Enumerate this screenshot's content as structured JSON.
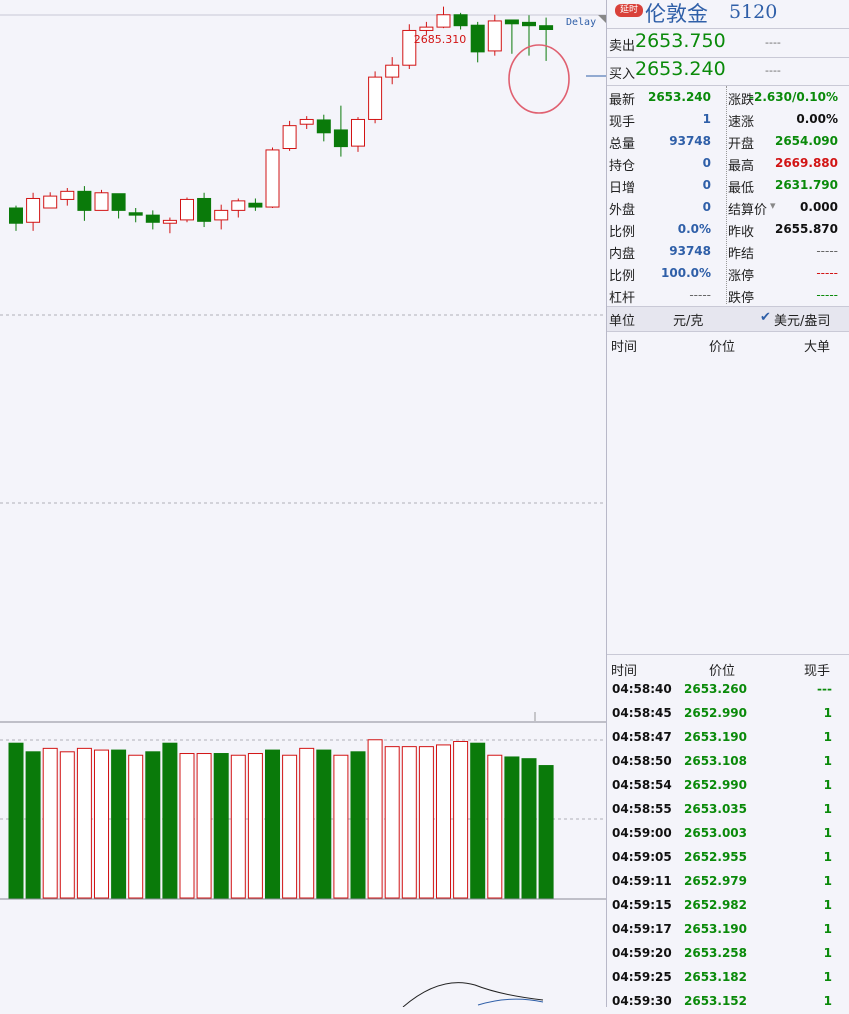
{
  "chart_data": {
    "type": "candlestick",
    "high_annotation": "2685.310",
    "delay_label": "Delay",
    "candles": [
      {
        "o": 2643.0,
        "h": 2643.5,
        "l": 2638.2,
        "c": 2639.8
      },
      {
        "o": 2640.0,
        "h": 2646.2,
        "l": 2638.2,
        "c": 2645.0
      },
      {
        "o": 2643.0,
        "h": 2646.3,
        "l": 2643.0,
        "c": 2645.5
      },
      {
        "o": 2644.8,
        "h": 2647.2,
        "l": 2643.5,
        "c": 2646.5
      },
      {
        "o": 2646.5,
        "h": 2647.6,
        "l": 2640.3,
        "c": 2642.5
      },
      {
        "o": 2642.5,
        "h": 2646.8,
        "l": 2642.5,
        "c": 2646.2
      },
      {
        "o": 2646.0,
        "h": 2646.0,
        "l": 2640.8,
        "c": 2642.5
      },
      {
        "o": 2642.0,
        "h": 2643.0,
        "l": 2640.0,
        "c": 2641.5
      },
      {
        "o": 2641.5,
        "h": 2642.5,
        "l": 2638.5,
        "c": 2640.0
      },
      {
        "o": 2639.8,
        "h": 2641.0,
        "l": 2637.7,
        "c": 2640.4
      },
      {
        "o": 2640.5,
        "h": 2645.2,
        "l": 2640.0,
        "c": 2644.8
      },
      {
        "o": 2645.0,
        "h": 2646.2,
        "l": 2639.0,
        "c": 2640.2
      },
      {
        "o": 2640.5,
        "h": 2643.7,
        "l": 2638.5,
        "c": 2642.5
      },
      {
        "o": 2642.5,
        "h": 2645.0,
        "l": 2641.0,
        "c": 2644.5
      },
      {
        "o": 2644.0,
        "h": 2645.0,
        "l": 2642.4,
        "c": 2643.2
      },
      {
        "o": 2643.2,
        "h": 2655.7,
        "l": 2643.0,
        "c": 2655.2
      },
      {
        "o": 2655.5,
        "h": 2661.3,
        "l": 2655.0,
        "c": 2660.3
      },
      {
        "o": 2660.6,
        "h": 2662.3,
        "l": 2659.6,
        "c": 2661.6
      },
      {
        "o": 2661.5,
        "h": 2662.6,
        "l": 2657.0,
        "c": 2658.8
      },
      {
        "o": 2659.4,
        "h": 2664.5,
        "l": 2653.8,
        "c": 2655.9
      },
      {
        "o": 2656.0,
        "h": 2662.1,
        "l": 2654.8,
        "c": 2661.6
      },
      {
        "o": 2661.6,
        "h": 2671.7,
        "l": 2660.8,
        "c": 2670.5
      },
      {
        "o": 2670.5,
        "h": 2674.7,
        "l": 2669.0,
        "c": 2673.0
      },
      {
        "o": 2673.0,
        "h": 2681.6,
        "l": 2672.2,
        "c": 2680.3
      },
      {
        "o": 2680.3,
        "h": 2682.1,
        "l": 2679.3,
        "c": 2681.0
      },
      {
        "o": 2681.0,
        "h": 2685.31,
        "l": 2680.8,
        "c": 2683.6
      },
      {
        "o": 2683.6,
        "h": 2684.0,
        "l": 2680.5,
        "c": 2681.3
      },
      {
        "o": 2681.4,
        "h": 2682.1,
        "l": 2673.6,
        "c": 2675.8
      },
      {
        "o": 2676.0,
        "h": 2683.6,
        "l": 2675.0,
        "c": 2682.3
      },
      {
        "o": 2682.5,
        "h": 2682.6,
        "l": 2675.4,
        "c": 2681.7
      },
      {
        "o": 2682.0,
        "h": 2683.5,
        "l": 2675.0,
        "c": 2681.3
      },
      {
        "o": 2681.3,
        "h": 2683.0,
        "l": 2673.9,
        "c": 2680.5
      }
    ],
    "volumes": [
      90,
      85,
      87,
      85,
      87,
      86,
      86,
      83,
      85,
      90,
      84,
      84,
      84,
      83,
      84,
      86,
      83,
      87,
      86,
      83,
      85,
      92,
      88,
      88,
      88,
      89,
      91,
      90,
      83,
      82,
      81,
      77
    ],
    "volume_colors": [
      "down",
      "down",
      "up",
      "up",
      "up",
      "up",
      "down",
      "up",
      "down",
      "down",
      "up",
      "up",
      "down",
      "up",
      "up",
      "down",
      "up",
      "up",
      "down",
      "up",
      "down",
      "up",
      "up",
      "up",
      "up",
      "up",
      "up",
      "down",
      "up",
      "down",
      "down",
      "down"
    ]
  },
  "header": {
    "badge": "延时",
    "name": "伦敦金",
    "code": "5120"
  },
  "quotes": {
    "sell_label": "卖出",
    "sell_price": "2653.750",
    "sell_vol": "----",
    "buy_label": "买入",
    "buy_price": "2653.240",
    "buy_vol": "----"
  },
  "stats_left": [
    {
      "label": "最新",
      "value": "2653.240",
      "cls": "green"
    },
    {
      "label": "现手",
      "value": "1",
      "cls": "blue"
    },
    {
      "label": "总量",
      "value": "93748",
      "cls": "blue"
    },
    {
      "label": "持仓",
      "value": "0",
      "cls": "blue"
    },
    {
      "label": "日增",
      "value": "0",
      "cls": "blue"
    },
    {
      "label": "外盘",
      "value": "0",
      "cls": "blue"
    },
    {
      "label": "比例",
      "value": "0.0%",
      "cls": "blue"
    },
    {
      "label": "内盘",
      "value": "93748",
      "cls": "blue"
    },
    {
      "label": "比例",
      "value": "100.0%",
      "cls": "blue"
    },
    {
      "label": "杠杆",
      "value": "-----",
      "cls": "dash-gray"
    }
  ],
  "stats_right": [
    {
      "label": "涨跌",
      "value": "-2.630/0.10%",
      "cls": "green"
    },
    {
      "label": "速涨",
      "value": "0.00%",
      "cls": "black"
    },
    {
      "label": "开盘",
      "value": "2654.090",
      "cls": "green"
    },
    {
      "label": "最高",
      "value": "2669.880",
      "cls": "red"
    },
    {
      "label": "最低",
      "value": "2631.790",
      "cls": "green"
    },
    {
      "label": "结算价",
      "value": "0.000",
      "cls": "black"
    },
    {
      "label": "昨收",
      "value": "2655.870",
      "cls": "black"
    },
    {
      "label": "昨结",
      "value": "-----",
      "cls": "dash-gray"
    },
    {
      "label": "涨停",
      "value": "-----",
      "cls": "dash-red"
    },
    {
      "label": "跌停",
      "value": "-----",
      "cls": "dash-green"
    }
  ],
  "units": {
    "label": "单位",
    "option1": "元/克",
    "option2": "美元/盎司"
  },
  "big_orders_header": {
    "time": "时间",
    "price": "价位",
    "big": "大单"
  },
  "ticks_header": {
    "time": "时间",
    "price": "价位",
    "vol": "现手"
  },
  "ticks": [
    {
      "time": "04:58:40",
      "price": "2653.260",
      "vol": "---"
    },
    {
      "time": "04:58:45",
      "price": "2652.990",
      "vol": "1"
    },
    {
      "time": "04:58:47",
      "price": "2653.190",
      "vol": "1"
    },
    {
      "time": "04:58:50",
      "price": "2653.108",
      "vol": "1"
    },
    {
      "time": "04:58:54",
      "price": "2652.990",
      "vol": "1"
    },
    {
      "time": "04:58:55",
      "price": "2653.035",
      "vol": "1"
    },
    {
      "time": "04:59:00",
      "price": "2653.003",
      "vol": "1"
    },
    {
      "time": "04:59:05",
      "price": "2652.955",
      "vol": "1"
    },
    {
      "time": "04:59:11",
      "price": "2652.979",
      "vol": "1"
    },
    {
      "time": "04:59:15",
      "price": "2652.982",
      "vol": "1"
    },
    {
      "time": "04:59:17",
      "price": "2653.190",
      "vol": "1"
    },
    {
      "time": "04:59:20",
      "price": "2653.258",
      "vol": "1"
    },
    {
      "time": "04:59:25",
      "price": "2653.182",
      "vol": "1"
    },
    {
      "time": "04:59:30",
      "price": "2653.152",
      "vol": "1"
    }
  ],
  "colors": {
    "up": "#d21414",
    "down": "#0a7a0a",
    "background": "#f4f4fa",
    "highlight_circle": "#e06070"
  }
}
